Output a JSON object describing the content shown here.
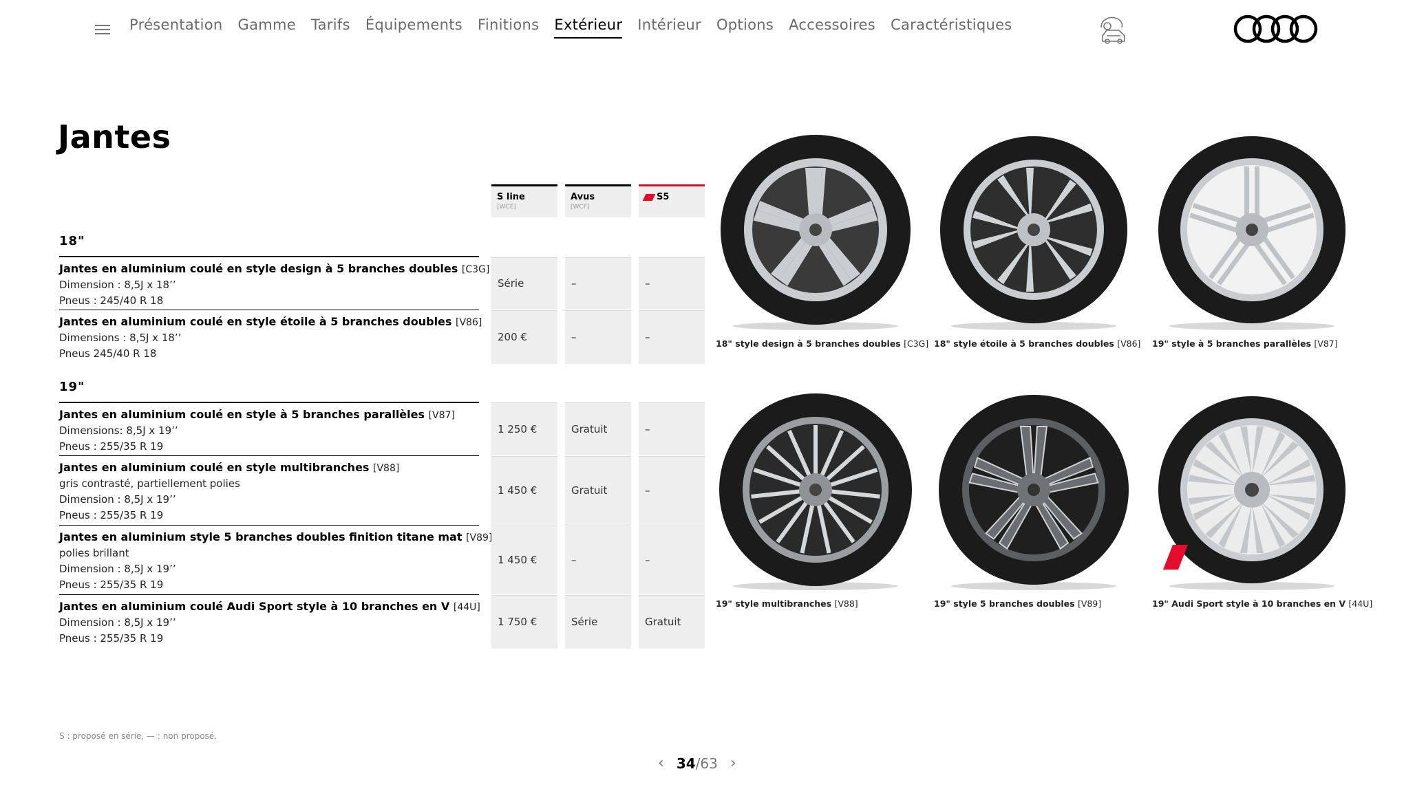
{
  "nav": {
    "items": [
      "Présentation",
      "Gamme",
      "Tarifs",
      "Équipements",
      "Finitions",
      "Extérieur",
      "Intérieur",
      "Options",
      "Accessoires",
      "Caractéristiques"
    ],
    "active": "Extérieur"
  },
  "page": {
    "title": "Jantes"
  },
  "columns": [
    {
      "name": "S line",
      "code": "[WCE]"
    },
    {
      "name": "Avus",
      "code": "[WCF]"
    },
    {
      "name": "S5",
      "code": ""
    }
  ],
  "groups": [
    {
      "label": "18\"",
      "rows": [
        {
          "title": "Jantes en aluminium coulé en style design à 5 branches doubles",
          "code": "[C3G]",
          "lines": [
            "Dimension : 8,5J x 18’’",
            "Pneus : 245/40 R 18"
          ],
          "values": [
            "Série",
            "–",
            "–"
          ]
        },
        {
          "title": "Jantes en aluminium coulé en style étoile à 5 branches doubles",
          "code": "[V86]",
          "lines": [
            "Dimensions : 8,5J x 18’’",
            "Pneus 245/40 R 18"
          ],
          "values": [
            "200 €",
            "–",
            "–"
          ]
        }
      ]
    },
    {
      "label": "19\"",
      "rows": [
        {
          "title": "Jantes en aluminium coulé en style à 5 branches parallèles",
          "code": "[V87]",
          "lines": [
            "Dimensions: 8,5J x 19’’",
            "Pneus : 255/35 R 19"
          ],
          "values": [
            "1 250 €",
            "Gratuit",
            "–"
          ]
        },
        {
          "title": "Jantes en aluminium coulé en style multibranches",
          "code": "[V88]",
          "lines": [
            "gris contrasté, partiellement polies",
            "Dimension : 8,5J x 19’’",
            "Pneus : 255/35 R 19"
          ],
          "values": [
            "1 450 €",
            "Gratuit",
            "–"
          ]
        },
        {
          "title": "Jantes en aluminium style 5 branches doubles finition titane mat",
          "code": "[V89]",
          "lines": [
            "polies brillant",
            "Dimension : 8,5J x 19’’",
            "Pneus : 255/35 R 19"
          ],
          "values": [
            "1 450 €",
            "–",
            "–"
          ]
        },
        {
          "title": "Jantes en aluminium coulé Audi Sport style à 10 branches en V",
          "code": "[44U]",
          "lines": [
            "Dimension :  8,5J x 19’’",
            "Pneus : 255/35 R 19"
          ],
          "values": [
            "1 750 €",
            "Série",
            "Gratuit"
          ]
        }
      ]
    }
  ],
  "wheels": [
    {
      "caption": "18\" style design à 5 branches doubles",
      "code": "[C3G]",
      "icon": "wheel-5-double-spoke"
    },
    {
      "caption": "18\" style étoile à 5 branches doubles",
      "code": "[V86]",
      "icon": "wheel-5-star"
    },
    {
      "caption": "19\" style à 5 branches parallèles",
      "code": "[V87]",
      "icon": "wheel-5-parallel"
    },
    {
      "caption": "19\" style multibranches",
      "code": "[V88]",
      "icon": "wheel-multi-spoke"
    },
    {
      "caption": "19\" style 5 branches doubles",
      "code": "[V89]",
      "icon": "wheel-5-double-titanium"
    },
    {
      "caption": "19\" Audi Sport style à 10 branches en V",
      "code": "[44U]",
      "icon": "wheel-10-v-spoke"
    }
  ],
  "footnote": "S : proposé en série, — : non proposé.",
  "pager": {
    "current": "34",
    "total": "/63"
  },
  "colors": {
    "s5_red": "#e30d2b",
    "cell_bg": "#eeeeee",
    "rim_silver": "#c9ccd0",
    "tire": "#1b1b1b"
  }
}
